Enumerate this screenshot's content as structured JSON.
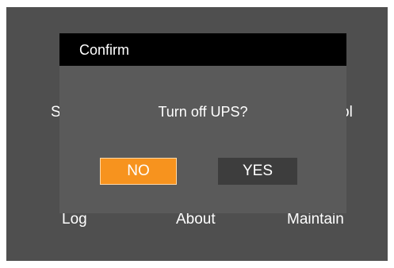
{
  "background_menu": {
    "left_item_partial": "S",
    "right_item_partial": "ol",
    "bottom_items": [
      "Log",
      "About",
      "Maintain"
    ]
  },
  "dialog": {
    "title": "Confirm",
    "message": "Turn off UPS?",
    "buttons": {
      "no_label": "NO",
      "yes_label": "YES"
    }
  },
  "colors": {
    "screen_bg": "#4f4f4f",
    "dialog_bg": "#5a5a5a",
    "titlebar_bg": "#000000",
    "selected_button": "#f7931e",
    "unselected_button": "#3d3d3d"
  }
}
